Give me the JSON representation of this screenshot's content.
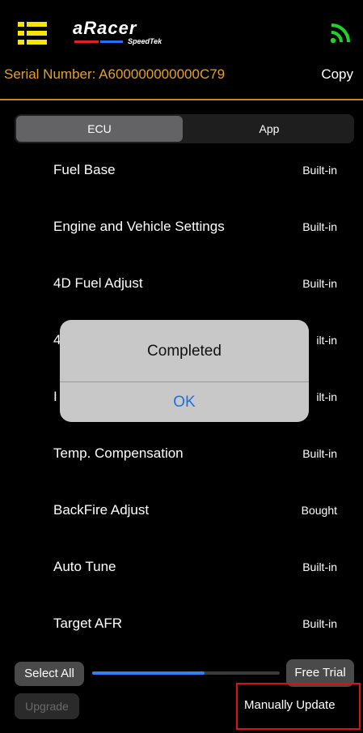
{
  "header": {
    "menu_icon": "menu-list-icon",
    "logo_text": "aRacer",
    "logo_sub": "SpeedTek",
    "connection_icon": "wifi-signal-icon",
    "connection_color": "#1fd12b",
    "menu_icon_color": "#f7e400"
  },
  "serial": {
    "text": "Serial Number: A600000000000C79",
    "copy_label": "Copy",
    "accent_color": "#e4a024"
  },
  "tabs": [
    {
      "label": "ECU",
      "selected": true
    },
    {
      "label": "App",
      "selected": false
    }
  ],
  "items": [
    {
      "label": "Fuel Base",
      "status": "Built-in"
    },
    {
      "label": "Engine and Vehicle Settings",
      "status": "Built-in"
    },
    {
      "label": "4D Fuel Adjust",
      "status": "Built-in"
    },
    {
      "label": "4",
      "status": "ilt-in"
    },
    {
      "label": "I",
      "status": "ilt-in"
    },
    {
      "label": "Temp. Compensation",
      "status": "Built-in"
    },
    {
      "label": "BackFire Adjust",
      "status": "Bought"
    },
    {
      "label": "Auto Tune",
      "status": "Built-in"
    },
    {
      "label": "Target AFR",
      "status": "Built-in"
    }
  ],
  "bottom": {
    "select_all_label": "Select All",
    "progress_fraction": 0.6,
    "progress_color": "#2f7ff5",
    "free_trial_label": "Free Trial",
    "upgrade_label": "Upgrade",
    "manually_update_label": "Manually Update",
    "highlight_color": "#e01010"
  },
  "alert": {
    "title": "Completed",
    "ok_label": "OK"
  }
}
